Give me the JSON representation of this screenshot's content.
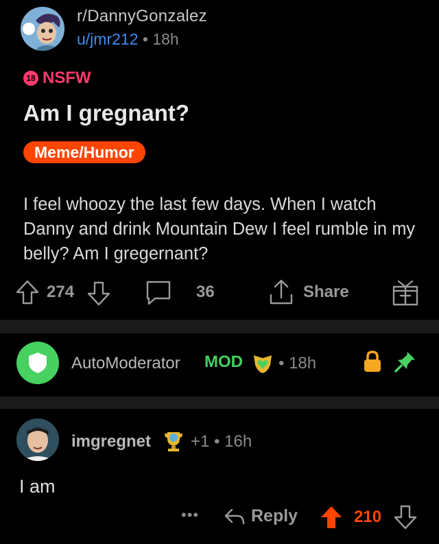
{
  "post": {
    "subreddit": "r/DannyGonzalez",
    "author": "u/jmr212",
    "separator": "•",
    "age": "18h",
    "nsfw_badge": "18",
    "nsfw_label": "NSFW",
    "title": "Am I gregnant?",
    "flair": "Meme/Humor",
    "body": "I feel whoozy the last few days. When I watch Danny and drink Mountain Dew I feel rumble in my belly? Am I gregernant?",
    "upvotes": "274",
    "comments": "36",
    "share_label": "Share"
  },
  "automod": {
    "name": "AutoModerator",
    "tag": "MOD",
    "separator": "•",
    "age": "18h"
  },
  "comment": {
    "author": "imgregnet",
    "karma": "+1",
    "separator": "•",
    "age": "16h",
    "text": "I am",
    "more": "•••",
    "reply_label": "Reply",
    "votes": "210"
  },
  "colors": {
    "accent": "#ff4500",
    "nsfw": "#ff3b6e",
    "mod_green": "#46d160",
    "link_blue": "#3d8cf0",
    "lock_orange": "#f5a623"
  },
  "icons": [
    "avatar",
    "nsfw-icon",
    "upvote-icon",
    "downvote-icon",
    "comment-icon",
    "share-icon",
    "award-icon",
    "shield-icon",
    "mod-badge-icon",
    "lock-icon",
    "pin-icon",
    "trophy-icon",
    "reply-icon",
    "more-icon"
  ]
}
